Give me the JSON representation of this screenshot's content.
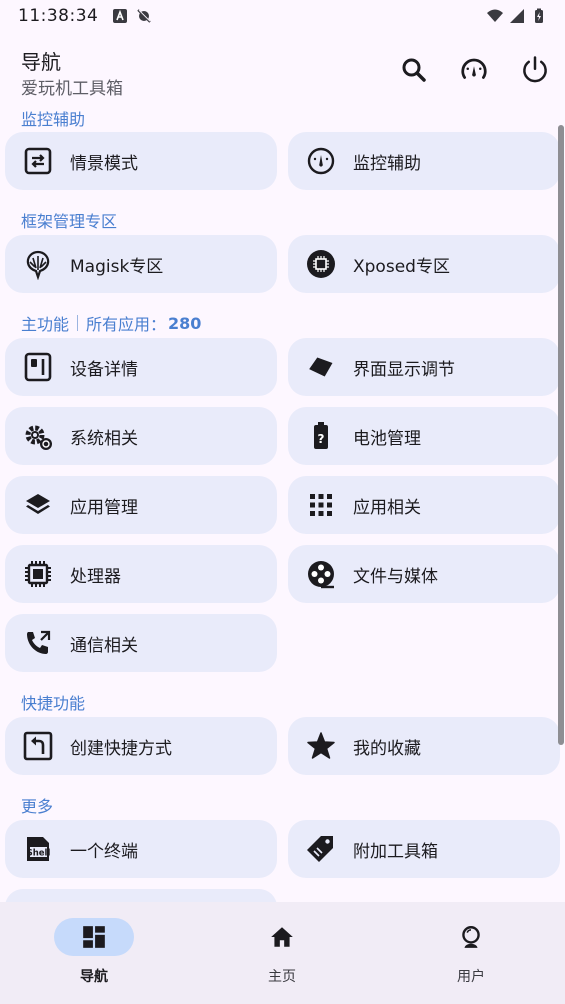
{
  "status_bar": {
    "time": "11:38:34",
    "left_icons": [
      "a-box-icon",
      "notification-off-icon"
    ],
    "right_icons": [
      "wifi-icon",
      "signal-icon",
      "battery-charging-icon"
    ]
  },
  "header": {
    "title": "导航",
    "subtitle": "爱玩机工具箱",
    "actions": [
      "search-icon",
      "speedometer-icon",
      "power-icon"
    ]
  },
  "sections": {
    "monitor": {
      "label": "监控辅助",
      "cards": [
        {
          "label": "情景模式",
          "icon": "swap-icon"
        },
        {
          "label": "监控辅助",
          "icon": "speedometer-icon"
        }
      ]
    },
    "framework": {
      "label": "框架管理专区",
      "cards": [
        {
          "label": "Magisk专区",
          "icon": "magisk-icon"
        },
        {
          "label": "Xposed专区",
          "icon": "xposed-chip-icon"
        }
      ]
    },
    "main": {
      "label": "主功能",
      "all_apps_label": "所有应用：",
      "all_apps_count": "280",
      "cards": [
        {
          "label": "设备详情",
          "icon": "device-icon"
        },
        {
          "label": "界面显示调节",
          "icon": "display-adjust-icon"
        },
        {
          "label": "系统相关",
          "icon": "settings-gear-icon"
        },
        {
          "label": "电池管理",
          "icon": "battery-unknown-icon"
        },
        {
          "label": "应用管理",
          "icon": "layers-icon"
        },
        {
          "label": "应用相关",
          "icon": "apps-grid-icon"
        },
        {
          "label": "处理器",
          "icon": "processor-icon"
        },
        {
          "label": "文件与媒体",
          "icon": "film-reel-icon"
        },
        {
          "label": "通信相关",
          "icon": "phone-icon"
        }
      ]
    },
    "shortcuts": {
      "label": "快捷功能",
      "cards": [
        {
          "label": "创建快捷方式",
          "icon": "shortcut-icon"
        },
        {
          "label": "我的收藏",
          "icon": "star-icon"
        }
      ]
    },
    "more": {
      "label": "更多",
      "cards": [
        {
          "label": "一个终端",
          "icon": "shell-icon"
        },
        {
          "label": "附加工具箱",
          "icon": "tag-icon"
        }
      ]
    }
  },
  "bottom_nav": {
    "items": [
      {
        "label": "导航",
        "icon": "dashboard-icon",
        "active": true
      },
      {
        "label": "主页",
        "icon": "home-icon",
        "active": false
      },
      {
        "label": "用户",
        "icon": "user-icon",
        "active": false
      }
    ]
  },
  "colors": {
    "background": "#fdf7ff",
    "card": "#e9ebfa",
    "section_label": "#4a7fd0",
    "nav_active_pill": "#c6dafb",
    "bottom_nav": "#f1ecf6"
  }
}
